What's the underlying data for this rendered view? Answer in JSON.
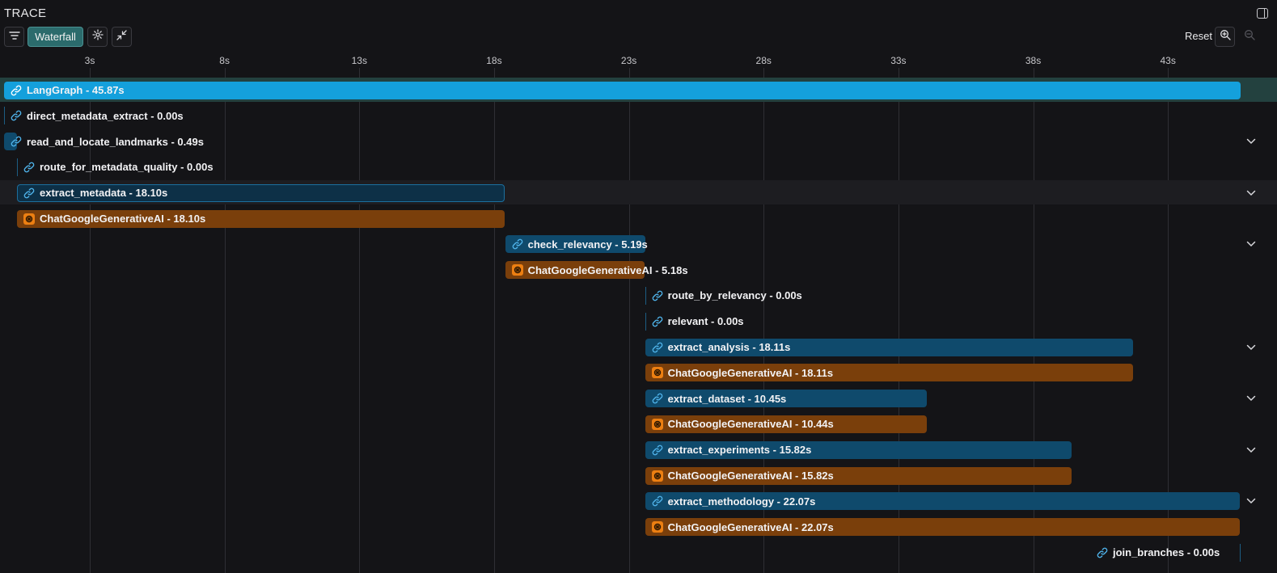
{
  "header": {
    "title": "TRACE"
  },
  "toolbar": {
    "view_label": "Waterfall",
    "reset_label": "Reset"
  },
  "timeline": {
    "ticks": [
      "3s",
      "8s",
      "13s",
      "18s",
      "23s",
      "28s",
      "33s",
      "38s",
      "43s"
    ]
  },
  "spans": [
    {
      "name": "LangGraph",
      "duration": "45.87s",
      "label": "LangGraph - 45.87s",
      "kind": "root",
      "start_s": 0.0,
      "duration_s": 45.87,
      "expandable": false
    },
    {
      "name": "direct_metadata_extract",
      "duration": "0.00s",
      "label": "direct_metadata_extract - 0.00s",
      "kind": "chain",
      "start_s": 0.0,
      "duration_s": 0.0,
      "expandable": false
    },
    {
      "name": "read_and_locate_landmarks",
      "duration": "0.49s",
      "label": "read_and_locate_landmarks - 0.49s",
      "kind": "chain",
      "start_s": 0.0,
      "duration_s": 0.49,
      "expandable": true
    },
    {
      "name": "route_for_metadata_quality",
      "duration": "0.00s",
      "label": "route_for_metadata_quality - 0.00s",
      "kind": "chain",
      "start_s": 0.49,
      "duration_s": 0.0,
      "expandable": false
    },
    {
      "name": "extract_metadata",
      "duration": "18.10s",
      "label": "extract_metadata - 18.10s",
      "kind": "chain",
      "start_s": 0.49,
      "duration_s": 18.1,
      "expandable": true,
      "selected": true
    },
    {
      "name": "ChatGoogleGenerativeAI",
      "duration": "18.10s",
      "label": "ChatGoogleGenerativeAI - 18.10s",
      "kind": "llm",
      "start_s": 0.49,
      "duration_s": 18.1,
      "expandable": false
    },
    {
      "name": "check_relevancy",
      "duration": "5.19s",
      "label": "check_relevancy - 5.19s",
      "kind": "chain",
      "start_s": 18.59,
      "duration_s": 5.19,
      "expandable": true
    },
    {
      "name": "ChatGoogleGenerativeAI",
      "duration": "5.18s",
      "label": "ChatGoogleGenerativeAI - 5.18s",
      "kind": "llm",
      "start_s": 18.59,
      "duration_s": 5.18,
      "expandable": false
    },
    {
      "name": "route_by_relevancy",
      "duration": "0.00s",
      "label": "route_by_relevancy - 0.00s",
      "kind": "chain",
      "start_s": 23.78,
      "duration_s": 0.0,
      "expandable": false
    },
    {
      "name": "relevant",
      "duration": "0.00s",
      "label": "relevant - 0.00s",
      "kind": "chain",
      "start_s": 23.78,
      "duration_s": 0.0,
      "expandable": false
    },
    {
      "name": "extract_analysis",
      "duration": "18.11s",
      "label": "extract_analysis - 18.11s",
      "kind": "chain",
      "start_s": 23.78,
      "duration_s": 18.11,
      "expandable": true
    },
    {
      "name": "ChatGoogleGenerativeAI",
      "duration": "18.11s",
      "label": "ChatGoogleGenerativeAI - 18.11s",
      "kind": "llm",
      "start_s": 23.78,
      "duration_s": 18.11,
      "expandable": false
    },
    {
      "name": "extract_dataset",
      "duration": "10.45s",
      "label": "extract_dataset - 10.45s",
      "kind": "chain",
      "start_s": 23.78,
      "duration_s": 10.45,
      "expandable": true
    },
    {
      "name": "ChatGoogleGenerativeAI",
      "duration": "10.44s",
      "label": "ChatGoogleGenerativeAI - 10.44s",
      "kind": "llm",
      "start_s": 23.78,
      "duration_s": 10.44,
      "expandable": false
    },
    {
      "name": "extract_experiments",
      "duration": "15.82s",
      "label": "extract_experiments - 15.82s",
      "kind": "chain",
      "start_s": 23.78,
      "duration_s": 15.82,
      "expandable": true
    },
    {
      "name": "ChatGoogleGenerativeAI",
      "duration": "15.82s",
      "label": "ChatGoogleGenerativeAI - 15.82s",
      "kind": "llm",
      "start_s": 23.78,
      "duration_s": 15.82,
      "expandable": false
    },
    {
      "name": "extract_methodology",
      "duration": "22.07s",
      "label": "extract_methodology - 22.07s",
      "kind": "chain",
      "start_s": 23.78,
      "duration_s": 22.07,
      "expandable": true
    },
    {
      "name": "ChatGoogleGenerativeAI",
      "duration": "22.07s",
      "label": "ChatGoogleGenerativeAI - 22.07s",
      "kind": "llm",
      "start_s": 23.78,
      "duration_s": 22.07,
      "expandable": false
    },
    {
      "name": "join_branches",
      "duration": "0.00s",
      "label": "join_branches - 0.00s",
      "kind": "chain",
      "start_s": 45.85,
      "duration_s": 0.0,
      "expandable": false,
      "label_left_of_bar": true
    }
  ],
  "colors": {
    "background": "#141417",
    "root_span": "#14a0dc",
    "chain_span": "#0f4a6c",
    "llm_span": "#7a3f0b",
    "llm_icon": "#ec7f12",
    "link_icon": "#4fb3ea",
    "active_toggle": "#2b6b6c"
  },
  "icons": {
    "filter": "filter-icon",
    "settings": "gear-icon",
    "collapse": "collapse-icon",
    "zoom_in": "zoom-in-icon",
    "zoom_out": "zoom-out-icon",
    "panel": "panel-toggle-icon",
    "chain": "link-icon",
    "llm": "llm-icon",
    "expand": "chevron-down-icon"
  }
}
